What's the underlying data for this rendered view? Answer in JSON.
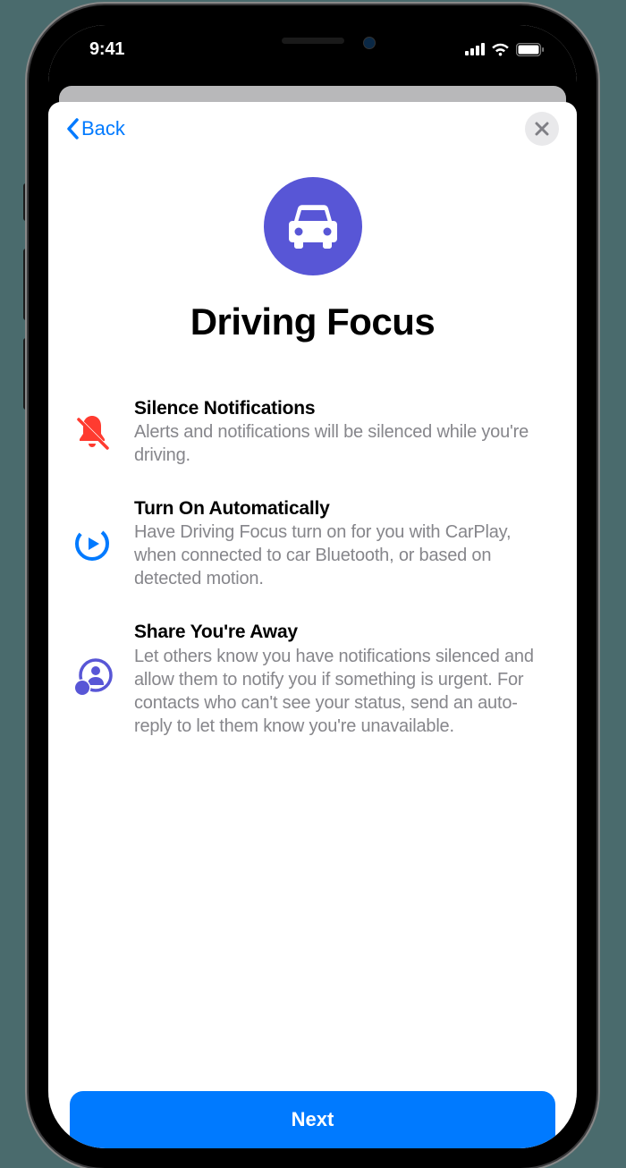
{
  "status": {
    "time": "9:41"
  },
  "nav": {
    "back_label": "Back"
  },
  "hero": {
    "title": "Driving Focus"
  },
  "features": [
    {
      "icon": "bell-slash-icon",
      "title": "Silence Notifications",
      "desc": "Alerts and notifications will be silenced while you're driving."
    },
    {
      "icon": "play-circle-icon",
      "title": "Turn On Automatically",
      "desc": "Have Driving Focus turn on for you with CarPlay, when connected to car Bluetooth, or based on detected motion."
    },
    {
      "icon": "person-status-icon",
      "title": "Share You're Away",
      "desc": "Let others know you have notifications silenced and allow them to notify you if something is urgent. For contacts who can't see your status, send an auto-reply to let them know you're unavailable."
    }
  ],
  "footer": {
    "next_label": "Next"
  }
}
